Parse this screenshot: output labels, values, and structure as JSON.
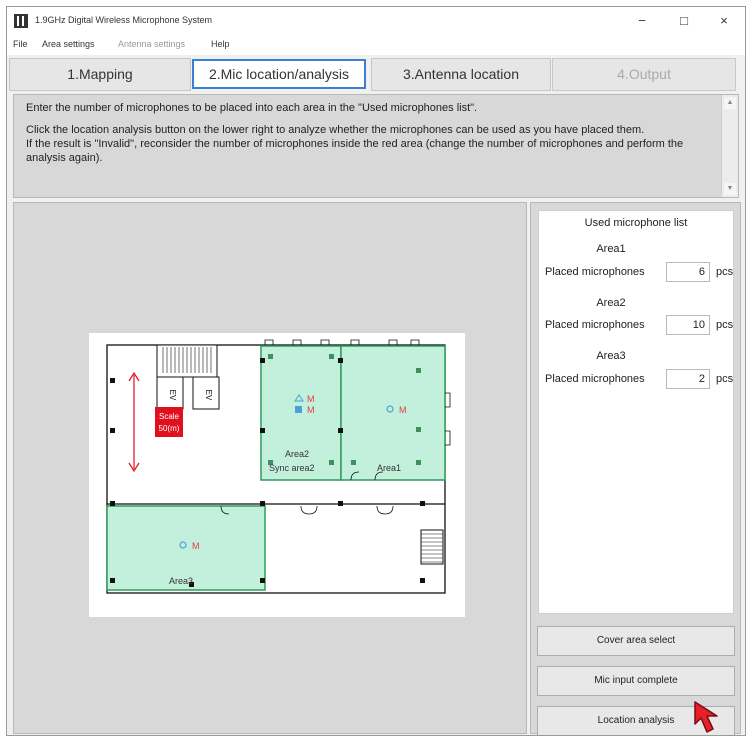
{
  "window": {
    "title": "1.9GHz Digital Wireless Microphone System"
  },
  "titlebar": {
    "minimize": "−",
    "maximize": "□",
    "close": "×"
  },
  "menu": [
    {
      "label": "File",
      "enabled": true
    },
    {
      "label": "Area settings",
      "enabled": true
    },
    {
      "label": "Antenna settings",
      "enabled": false
    },
    {
      "label": "Help",
      "enabled": true
    }
  ],
  "tabs": [
    {
      "label": "1.Mapping",
      "state": "normal"
    },
    {
      "label": "2.Mic location/analysis",
      "state": "active"
    },
    {
      "label": "3.Antenna location",
      "state": "normal"
    },
    {
      "label": "4.Output",
      "state": "disabled"
    }
  ],
  "instructions": {
    "line1": "Enter the number of microphones to be placed into each area in the \"Used microphones list\".",
    "line2": "Click the location analysis button on the lower right to analyze whether the microphones can be used as you have placed them.",
    "line3": "If the result is \"Invalid\", reconsider the number of microphones inside the red area (change the number of microphones and perform the analysis again)."
  },
  "floor_plan": {
    "ev_left": "EV",
    "ev_right": "EV",
    "scale_label_line1": "Scale",
    "scale_label_line2": "50(m)",
    "mic_letter": "M",
    "area1_label": "Area1",
    "area2_label": "Area2",
    "area2_sync_label": "Sync area2",
    "area3_label": "Area3",
    "colors": {
      "area_fill": "#c2f0dc",
      "area_border": "#2f9c5a",
      "mic_text": "#e04040",
      "scale_fill": "#e0101f",
      "antenna": "#4aa0d8"
    }
  },
  "used_mic_list": {
    "title": "Used microphone list",
    "placed_label": "Placed microphones",
    "unit": "pcs",
    "areas": [
      {
        "name": "Area1",
        "count": "6"
      },
      {
        "name": "Area2",
        "count": "10"
      },
      {
        "name": "Area3",
        "count": "2"
      }
    ]
  },
  "buttons": {
    "cover_area": "Cover area select",
    "mic_input": "Mic input complete",
    "location_analysis": "Location analysis"
  }
}
